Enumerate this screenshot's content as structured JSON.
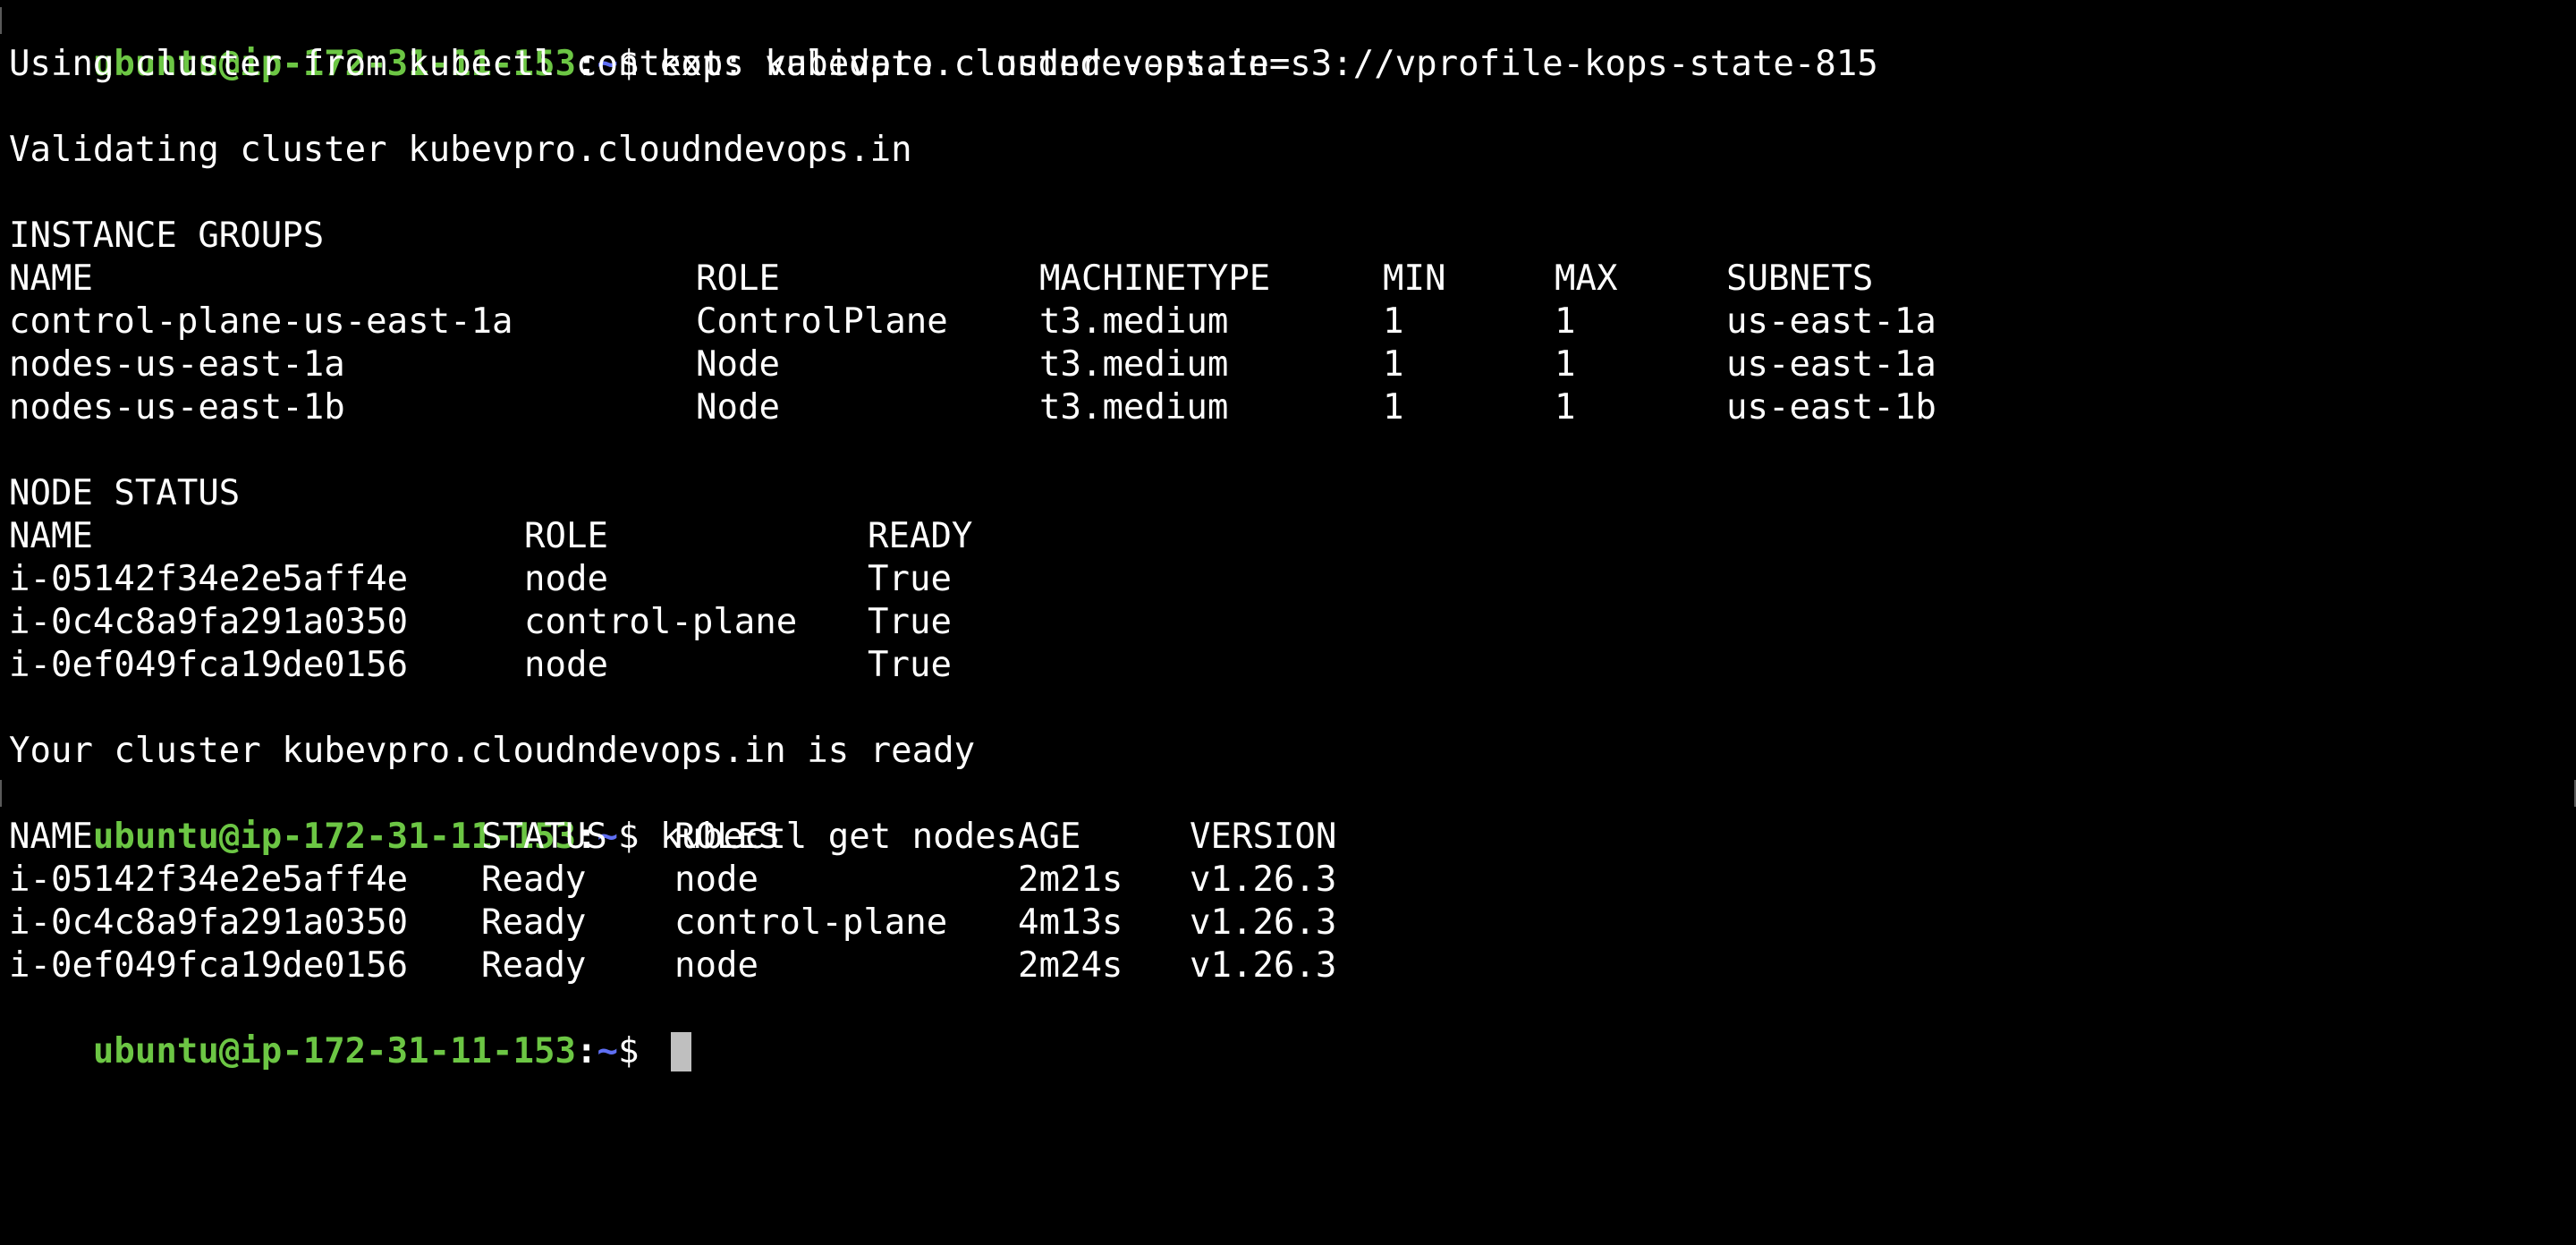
{
  "prompt": {
    "user_host": "ubuntu@ip-172-31-11-153",
    "sep": ":",
    "path": "~",
    "symbol": "$ "
  },
  "commands": {
    "kops": "kops validate cluster --state=s3://vprofile-kops-state-815",
    "kubectl": "kubectl get nodes"
  },
  "output": {
    "using_cluster": "Using cluster from kubectl context: kubevpro.cloudndevops.in",
    "validating": "Validating cluster kubevpro.cloudndevops.in",
    "instance_groups_title": "INSTANCE GROUPS",
    "node_status_title": "NODE STATUS",
    "ready_msg": "Your cluster kubevpro.cloudndevops.in is ready"
  },
  "instance_groups": {
    "headers": [
      "NAME",
      "ROLE",
      "MACHINETYPE",
      "MIN",
      "MAX",
      "SUBNETS"
    ],
    "rows": [
      [
        "control-plane-us-east-1a",
        "ControlPlane",
        "t3.medium",
        "1",
        "1",
        "us-east-1a"
      ],
      [
        "nodes-us-east-1a",
        "Node",
        "t3.medium",
        "1",
        "1",
        "us-east-1a"
      ],
      [
        "nodes-us-east-1b",
        "Node",
        "t3.medium",
        "1",
        "1",
        "us-east-1b"
      ]
    ]
  },
  "node_status": {
    "headers": [
      "NAME",
      "ROLE",
      "READY"
    ],
    "rows": [
      [
        "i-05142f34e2e5aff4e",
        "node",
        "True"
      ],
      [
        "i-0c4c8a9fa291a0350",
        "control-plane",
        "True"
      ],
      [
        "i-0ef049fca19de0156",
        "node",
        "True"
      ]
    ]
  },
  "nodes": {
    "headers": [
      "NAME",
      "STATUS",
      "ROLES",
      "AGE",
      "VERSION"
    ],
    "rows": [
      [
        "i-05142f34e2e5aff4e",
        "Ready",
        "node",
        "2m21s",
        "v1.26.3"
      ],
      [
        "i-0c4c8a9fa291a0350",
        "Ready",
        "control-plane",
        "4m13s",
        "v1.26.3"
      ],
      [
        "i-0ef049fca19de0156",
        "Ready",
        "node",
        "2m24s",
        "v1.26.3"
      ]
    ]
  },
  "colors": {
    "background": "#000000",
    "text": "#ffffff",
    "prompt_user": "#6cc644",
    "prompt_path": "#5f6ff3",
    "cursor": "#bfbfbf"
  }
}
